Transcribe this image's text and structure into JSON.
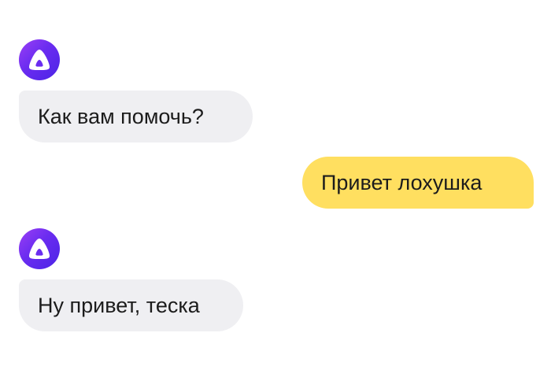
{
  "assistant": {
    "avatar_icon": "alice-assistant-icon",
    "avatar_gradient": [
      "#9a3ff5",
      "#4b24e6"
    ]
  },
  "colors": {
    "incoming_bubble": "#efeff2",
    "outgoing_bubble": "#ffdf60",
    "text": "#1c1c1c"
  },
  "messages": [
    {
      "sender": "assistant",
      "text": "Как вам помочь?"
    },
    {
      "sender": "user",
      "text": "Привет лохушка"
    },
    {
      "sender": "assistant",
      "text": "Ну привет, теска"
    }
  ]
}
